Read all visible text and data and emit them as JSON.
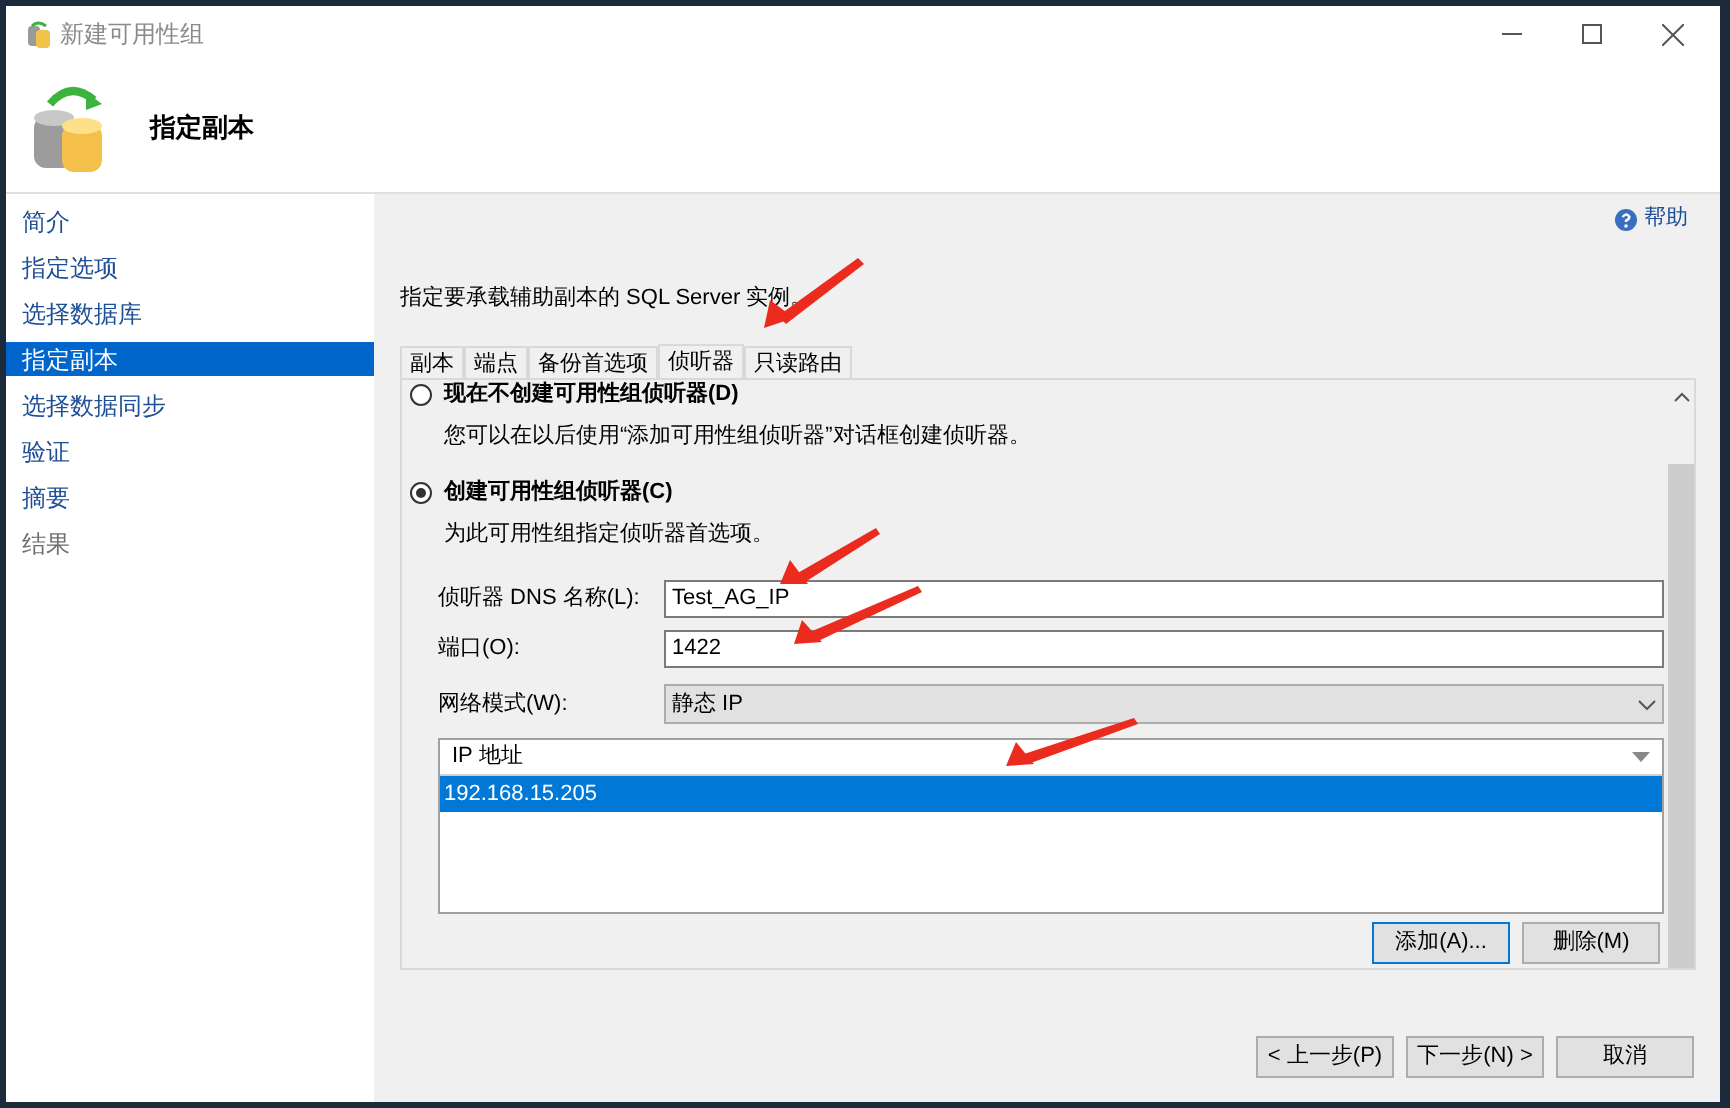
{
  "window": {
    "title": "新建可用性组"
  },
  "header": {
    "title": "指定副本"
  },
  "sidebar": {
    "items": [
      {
        "label": "简介",
        "selected": false,
        "disabled": false
      },
      {
        "label": "指定选项",
        "selected": false,
        "disabled": false
      },
      {
        "label": "选择数据库",
        "selected": false,
        "disabled": false
      },
      {
        "label": "指定副本",
        "selected": true,
        "disabled": false
      },
      {
        "label": "选择数据同步",
        "selected": false,
        "disabled": false
      },
      {
        "label": "验证",
        "selected": false,
        "disabled": false
      },
      {
        "label": "摘要",
        "selected": false,
        "disabled": false
      },
      {
        "label": "结果",
        "selected": false,
        "disabled": true
      }
    ]
  },
  "help": {
    "label": "帮助"
  },
  "description": "指定要承载辅助副本的 SQL Server 实例。",
  "tabs": [
    {
      "label": "副本",
      "selected": false
    },
    {
      "label": "端点",
      "selected": false
    },
    {
      "label": "备份首选项",
      "selected": false
    },
    {
      "label": "侦听器",
      "selected": true
    },
    {
      "label": "只读路由",
      "selected": false
    }
  ],
  "listener_options": [
    {
      "label": "现在不创建可用性组侦听器(D)",
      "selected": false,
      "hint": "您可以在以后使用“添加可用性组侦听器”对话框创建侦听器。"
    },
    {
      "label": "创建可用性组侦听器(C)",
      "selected": true,
      "hint": "为此可用性组指定侦听器首选项。"
    }
  ],
  "fields": [
    {
      "kind": "text",
      "label": "侦听器 DNS 名称(L):",
      "value": "Test_AG_IP"
    },
    {
      "kind": "text",
      "label": "端口(O):",
      "value": "1422"
    },
    {
      "kind": "select",
      "label": "网络模式(W):",
      "value": "静态 IP"
    }
  ],
  "ip_grid": {
    "column": "IP 地址",
    "rows": [
      {
        "value": "192.168.15.205",
        "selected": true
      }
    ]
  },
  "grid_buttons": [
    {
      "label": "添加(A)...",
      "focused": true
    },
    {
      "label": "删除(M)",
      "focused": false
    }
  ],
  "nav_buttons": [
    "< 上一步(P)",
    "下一步(N) >",
    "取消"
  ]
}
